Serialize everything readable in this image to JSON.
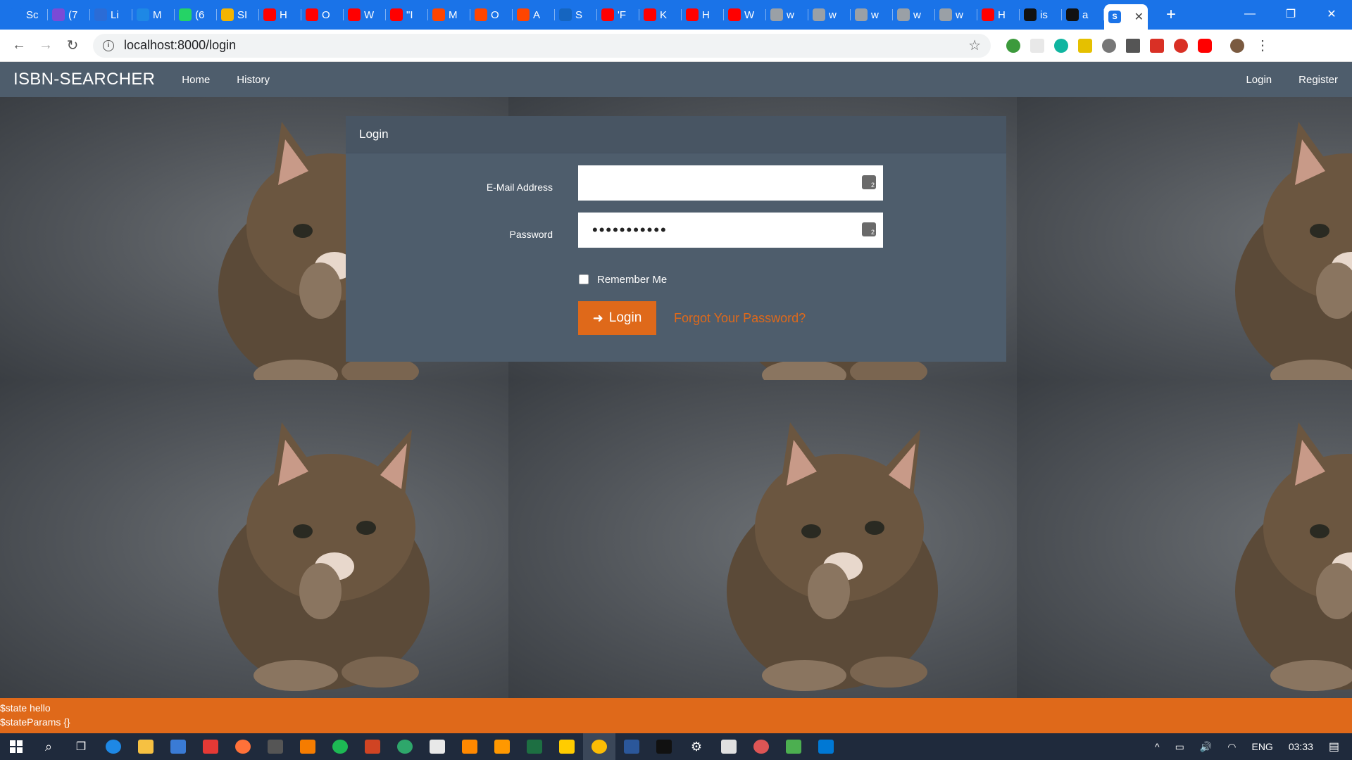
{
  "browser": {
    "tabs": [
      {
        "title": "Sc",
        "icon": "s-logo-icon",
        "color": "#1a73e8"
      },
      {
        "title": "(7",
        "icon": "mail-icon",
        "color": "#7b4bd6"
      },
      {
        "title": "Li",
        "icon": "check-icon",
        "color": "#2b6cd6"
      },
      {
        "title": "M",
        "icon": "feather-icon",
        "color": "#1e88e5"
      },
      {
        "title": "(6",
        "icon": "whatsapp-icon",
        "color": "#25d366"
      },
      {
        "title": "SI",
        "icon": "pinwheel-icon",
        "color": "#f4b400"
      },
      {
        "title": "H",
        "icon": "youtube-icon",
        "color": "#ff0000"
      },
      {
        "title": "O",
        "icon": "youtube-icon",
        "color": "#ff0000"
      },
      {
        "title": "W",
        "icon": "youtube-icon",
        "color": "#ff0000"
      },
      {
        "title": "\"I",
        "icon": "youtube-icon",
        "color": "#ff0000"
      },
      {
        "title": "M",
        "icon": "reddit-icon",
        "color": "#ff4500"
      },
      {
        "title": "O",
        "icon": "reddit-icon",
        "color": "#ff4500"
      },
      {
        "title": "A",
        "icon": "reddit-icon",
        "color": "#ff4500"
      },
      {
        "title": "S",
        "icon": "ss-logo-icon",
        "color": "#1565c0"
      },
      {
        "title": "'F",
        "icon": "youtube-icon",
        "color": "#ff0000"
      },
      {
        "title": "K",
        "icon": "youtube-icon",
        "color": "#ff0000"
      },
      {
        "title": "H",
        "icon": "youtube-icon",
        "color": "#ff0000"
      },
      {
        "title": "W",
        "icon": "youtube-icon",
        "color": "#ff0000"
      },
      {
        "title": "w",
        "icon": "globe-icon",
        "color": "#9aa0a6"
      },
      {
        "title": "w",
        "icon": "globe-icon",
        "color": "#9aa0a6"
      },
      {
        "title": "w",
        "icon": "globe-icon",
        "color": "#9aa0a6"
      },
      {
        "title": "w",
        "icon": "globe-icon",
        "color": "#9aa0a6"
      },
      {
        "title": "w",
        "icon": "globe-icon",
        "color": "#9aa0a6"
      },
      {
        "title": "H",
        "icon": "youtube-icon",
        "color": "#ff0000"
      },
      {
        "title": "is",
        "icon": "github-icon",
        "color": "#111111"
      },
      {
        "title": "a",
        "icon": "github-icon",
        "color": "#111111"
      }
    ],
    "active_tab": {
      "icon": "s-logo-icon",
      "color": "#1a73e8"
    },
    "url": "localhost:8000/login"
  },
  "site": {
    "brand": "ISBN-SEARCHER",
    "nav": {
      "home": "Home",
      "history": "History",
      "login": "Login",
      "register": "Register"
    }
  },
  "login_card": {
    "title": "Login",
    "email_label": "E-Mail Address",
    "email_value": "",
    "password_label": "Password",
    "password_value": "•••••••••••",
    "remember_label": "Remember Me",
    "remember_checked": false,
    "submit_label": "Login",
    "forgot_label": "Forgot Your Password?"
  },
  "debug": {
    "line1": "$state hello",
    "line2": "$stateParams {}"
  },
  "taskbar": {
    "language": "ENG",
    "time": "03:33"
  },
  "colors": {
    "accent": "#df691a",
    "panel": "#4e5d6c"
  }
}
